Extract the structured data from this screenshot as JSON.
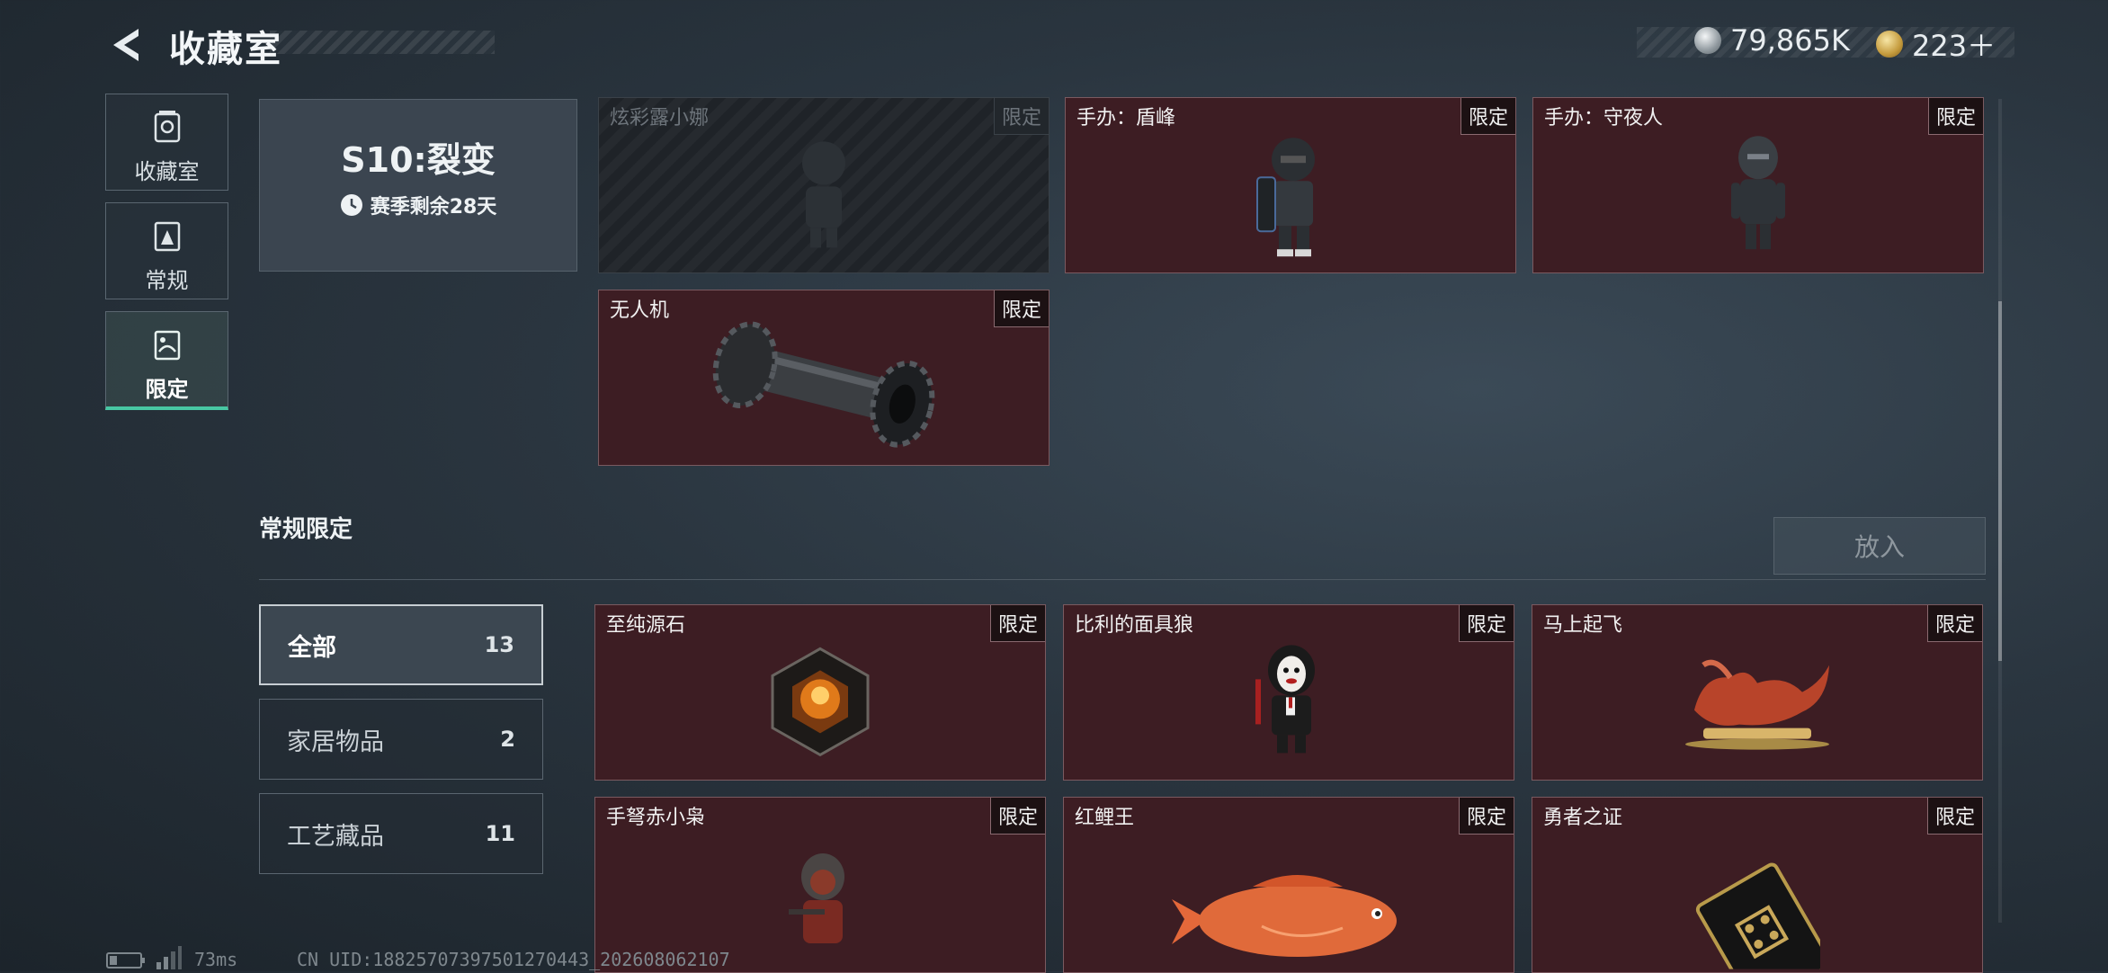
{
  "header": {
    "title": "收藏室",
    "currency_silver": "79,865K",
    "currency_gold": "223＋"
  },
  "nav": [
    {
      "label": "收藏室",
      "icon": "collection-icon"
    },
    {
      "label": "常规",
      "icon": "regular-icon"
    },
    {
      "label": "限定",
      "icon": "limited-icon"
    }
  ],
  "season": {
    "title": "S10:裂变",
    "remaining": "赛季剩余28天"
  },
  "season_items": [
    {
      "name": "炫彩露小娜",
      "tag": "限定",
      "state": "locked"
    },
    {
      "name": "手办：盾峰",
      "tag": "限定"
    },
    {
      "name": "手办：守夜人",
      "tag": "限定"
    },
    {
      "name": "无人机",
      "tag": "限定"
    }
  ],
  "section": {
    "title": "常规限定",
    "put_button": "放入"
  },
  "categories": [
    {
      "label": "全部",
      "count": "13"
    },
    {
      "label": "家居物品",
      "count": "2"
    },
    {
      "label": "工艺藏品",
      "count": "11"
    }
  ],
  "regular_items": [
    {
      "name": "至纯源石",
      "tag": "限定"
    },
    {
      "name": "比利的面具狼",
      "tag": "限定"
    },
    {
      "name": "马上起飞",
      "tag": "限定"
    },
    {
      "name": "手弩赤小枭",
      "tag": "限定"
    },
    {
      "name": "红鲤王",
      "tag": "限定"
    },
    {
      "name": "勇者之证",
      "tag": "限定"
    }
  ],
  "status": {
    "ping": "73ms",
    "uid": "CN UID:18825707397501270443_202608062107"
  },
  "colors": {
    "accent": "#48c7a3",
    "card_bg": "#3d1d23"
  }
}
